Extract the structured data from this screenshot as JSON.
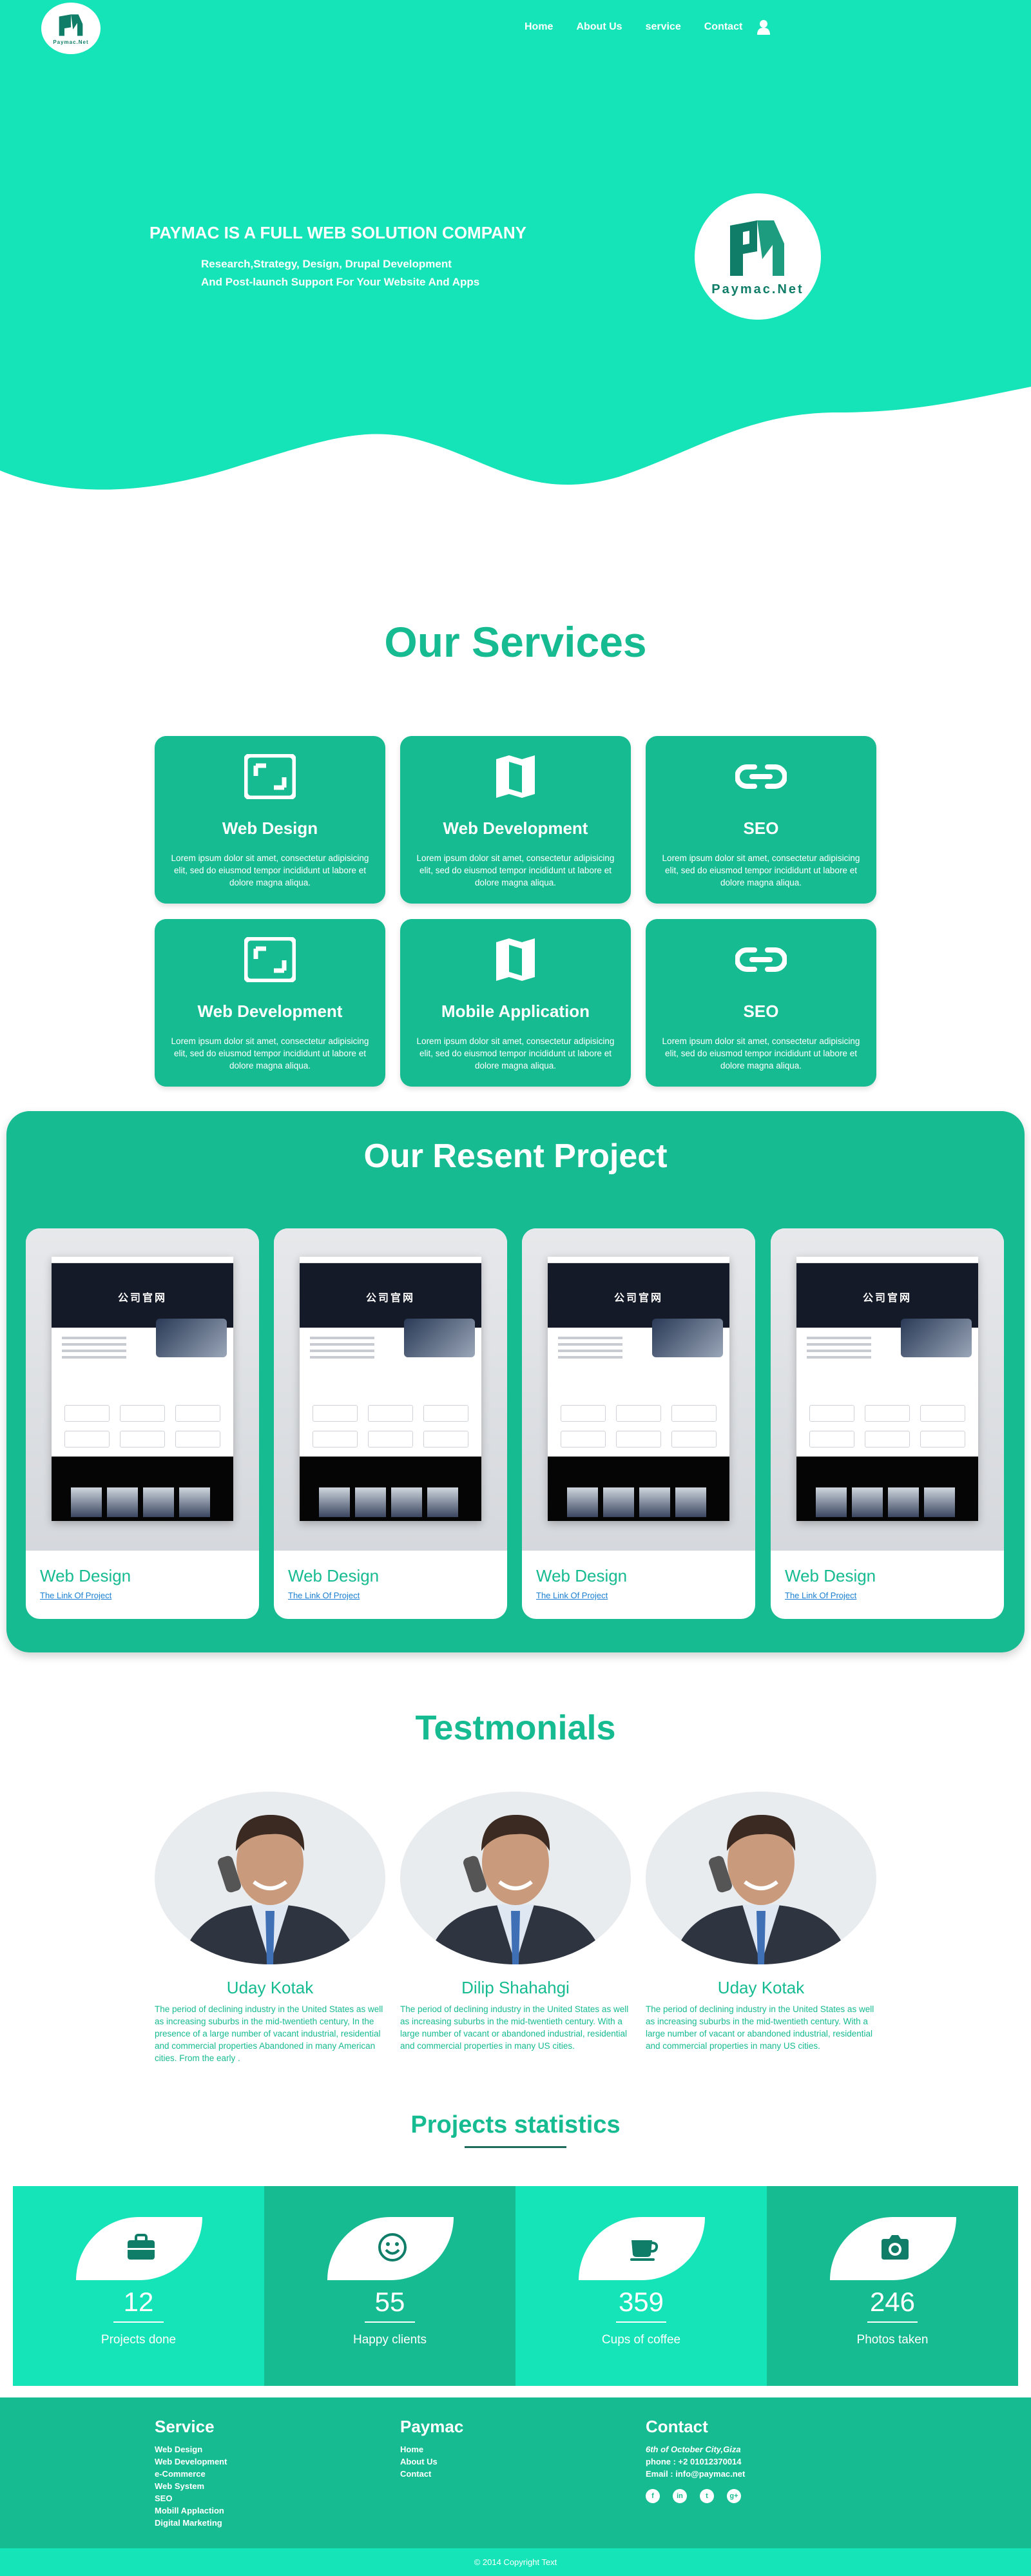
{
  "brand": {
    "logo_text": "Paymac.Net"
  },
  "nav": {
    "items": [
      "Home",
      "About Us",
      "service",
      "Contact"
    ]
  },
  "hero": {
    "title": "PAYMAC IS A FULL WEB SOLUTION COMPANY",
    "subtitle_line1": "Research,Strategy, Design, Drupal Development",
    "subtitle_line2": "And Post-launch Support For Your Website And Apps"
  },
  "services": {
    "title": "Our Services",
    "items": [
      {
        "title": "Web Design",
        "icon": "image-frame-icon",
        "text": "Lorem ipsum dolor sit amet, consectetur adipisicing elit, sed do eiusmod tempor incididunt ut labore et dolore magna aliqua."
      },
      {
        "title": "Web Development",
        "icon": "map-icon",
        "text": "Lorem ipsum dolor sit amet, consectetur adipisicing elit, sed do eiusmod tempor incididunt ut labore et dolore magna aliqua."
      },
      {
        "title": "SEO",
        "icon": "link-icon",
        "text": "Lorem ipsum dolor sit amet, consectetur adipisicing elit, sed do eiusmod tempor incididunt ut labore et dolore magna aliqua."
      },
      {
        "title": "Web Development",
        "icon": "image-frame-icon",
        "text": "Lorem ipsum dolor sit amet, consectetur adipisicing elit, sed do eiusmod tempor incididunt ut labore et dolore magna aliqua."
      },
      {
        "title": "Mobile Application",
        "icon": "map-icon",
        "text": "Lorem ipsum dolor sit amet, consectetur adipisicing elit, sed do eiusmod tempor incididunt ut labore et dolore magna aliqua."
      },
      {
        "title": "SEO",
        "icon": "link-icon",
        "text": "Lorem ipsum dolor sit amet, consectetur adipisicing elit, sed do eiusmod tempor incididunt ut labore et dolore magna aliqua."
      }
    ]
  },
  "projects": {
    "title": "Our Resent Project",
    "screen_heading": "公司官网",
    "items": [
      {
        "name": "Web Design",
        "link": "The Link Of Project"
      },
      {
        "name": "Web Design",
        "link": "The Link Of Project"
      },
      {
        "name": "Web Design",
        "link": "The Link Of Project"
      },
      {
        "name": "Web Design",
        "link": "The Link Of Project"
      }
    ]
  },
  "testimonials": {
    "title": "Testmonials",
    "items": [
      {
        "name": "Uday Kotak",
        "text": "The period of declining industry in the United States as well as increasing suburbs in the mid-twentieth century, In the presence of a large number of vacant industrial, residential and commercial properties Abandoned in many American cities. From the early ."
      },
      {
        "name": "Dilip Shahahgi",
        "text": "The period of declining industry in the United States as well as increasing suburbs in the mid-twentieth century. With a large number of vacant or abandoned industrial, residential and commercial properties in many US cities."
      },
      {
        "name": "Uday Kotak",
        "text": "The period of declining industry in the United States as well as increasing suburbs in the mid-twentieth century. With a large number of vacant or abandoned industrial, residential and commercial properties in many US cities."
      }
    ]
  },
  "stats": {
    "title": "Projects statistics",
    "items": [
      {
        "value": "12",
        "label": "Projects done",
        "icon": "briefcase-icon",
        "bg": "#15e4b8"
      },
      {
        "value": "55",
        "label": "Happy clients",
        "icon": "smiley-icon",
        "bg": "#17bb91"
      },
      {
        "value": "359",
        "label": "Cups of coffee",
        "icon": "coffee-cup-icon",
        "bg": "#15e4b8"
      },
      {
        "value": "246",
        "label": "Photos taken",
        "icon": "camera-icon",
        "bg": "#17bb91"
      }
    ]
  },
  "footer": {
    "service": {
      "title": "Service",
      "links": [
        "Web Design",
        "Web Development",
        "e-Commerce",
        "Web System",
        "SEO",
        "Mobill Applaction",
        "Digital Marketing"
      ]
    },
    "paymac": {
      "title": "Paymac",
      "links": [
        "Home",
        "About Us",
        "Contact"
      ]
    },
    "contact": {
      "title": "Contact",
      "address": "6th of October City,Giza",
      "phone": "phone : +2 01012370014",
      "email": "Email : info@paymac.net",
      "socials": [
        "f",
        "in",
        "t",
        "g+"
      ]
    },
    "copyright": "© 2014 Copyright Text"
  },
  "colors": {
    "bright_teal": "#15e4b8",
    "teal": "#17bb91",
    "dark_teal": "#0f7d67",
    "link_blue": "#1a7fd1"
  }
}
